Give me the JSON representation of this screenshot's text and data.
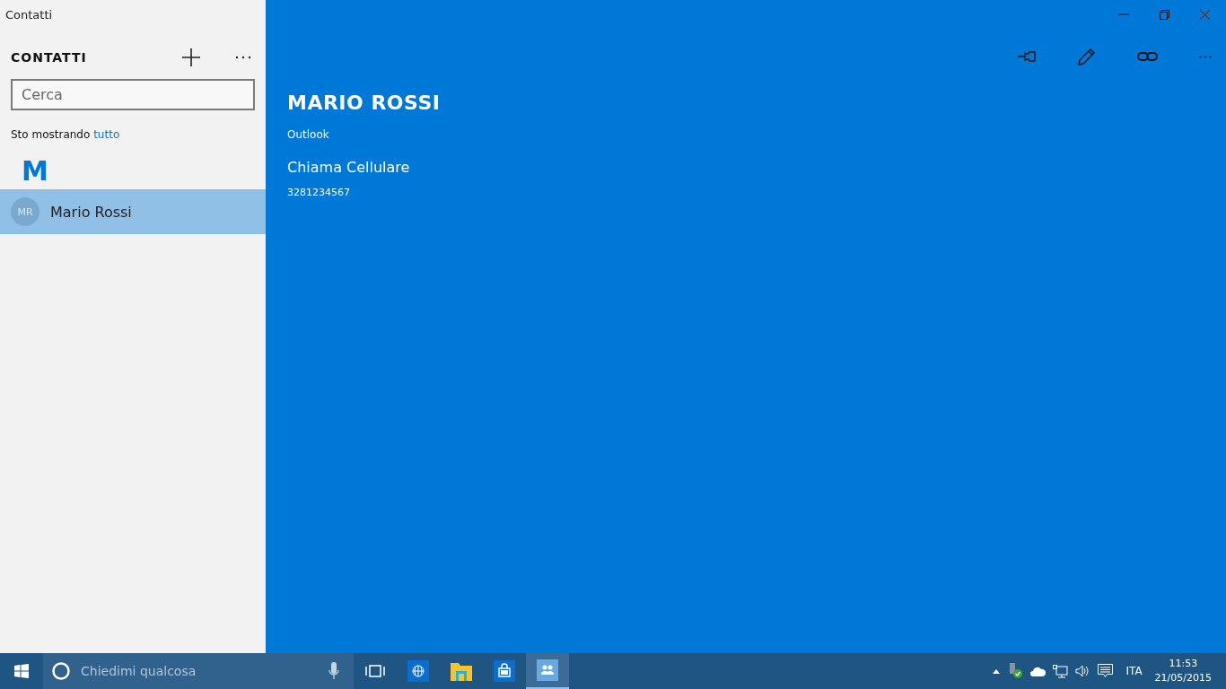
{
  "window": {
    "title": "Contatti"
  },
  "sidebar": {
    "heading": "CONTATTI",
    "search": {
      "placeholder": "Cerca"
    },
    "filter": {
      "label": "Sto mostrando",
      "link": "tutto"
    },
    "groups": [
      {
        "letter": "M",
        "contacts": [
          {
            "initials": "MR",
            "name": "Mario Rossi",
            "selected": true
          }
        ]
      }
    ]
  },
  "contact": {
    "name": "MARIO ROSSI",
    "source": "Outlook",
    "actions": [
      {
        "label": "Chiama Cellulare",
        "value": "3281234567"
      }
    ]
  },
  "taskbar": {
    "search": {
      "placeholder": "Chiedimi qualcosa"
    },
    "apps": [
      {
        "kind": "browser",
        "selected": false
      },
      {
        "kind": "folder",
        "selected": false
      },
      {
        "kind": "store",
        "selected": false
      },
      {
        "kind": "people",
        "selected": true
      }
    ],
    "language": "ITA",
    "time": "11:53",
    "date": "21/05/2015"
  }
}
